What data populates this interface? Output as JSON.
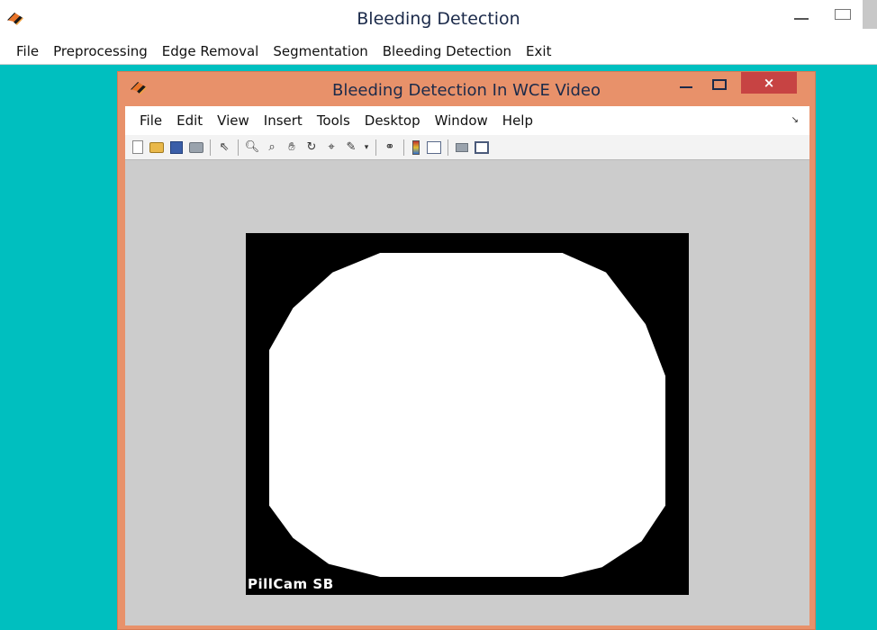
{
  "main_window": {
    "title": "Bleeding Detection",
    "menu": [
      "File",
      "Preprocessing",
      "Edge Removal",
      "Segmentation",
      "Bleeding Detection",
      "Exit"
    ]
  },
  "figure_window": {
    "title": "Bleeding Detection In WCE Video",
    "close_symbol": "×",
    "menu": [
      "File",
      "Edit",
      "View",
      "Insert",
      "Tools",
      "Desktop",
      "Window",
      "Help"
    ],
    "toolbar_icons": [
      "new-figure-icon",
      "open-file-icon",
      "save-figure-icon",
      "print-figure-icon",
      "edit-plot-arrow-icon",
      "zoom-in-icon",
      "zoom-out-icon",
      "pan-hand-icon",
      "rotate-3d-icon",
      "data-cursor-icon",
      "brush-icon",
      "link-plot-icon",
      "insert-colorbar-icon",
      "insert-legend-icon",
      "hide-plot-tools-icon",
      "show-plot-tools-icon"
    ],
    "image": {
      "caption": "PillCam SB"
    }
  },
  "colors": {
    "desktop_background": "#00bfbf",
    "figure_frame": "#e8916a",
    "figure_client": "#cccccc",
    "close_button": "#c74343"
  }
}
